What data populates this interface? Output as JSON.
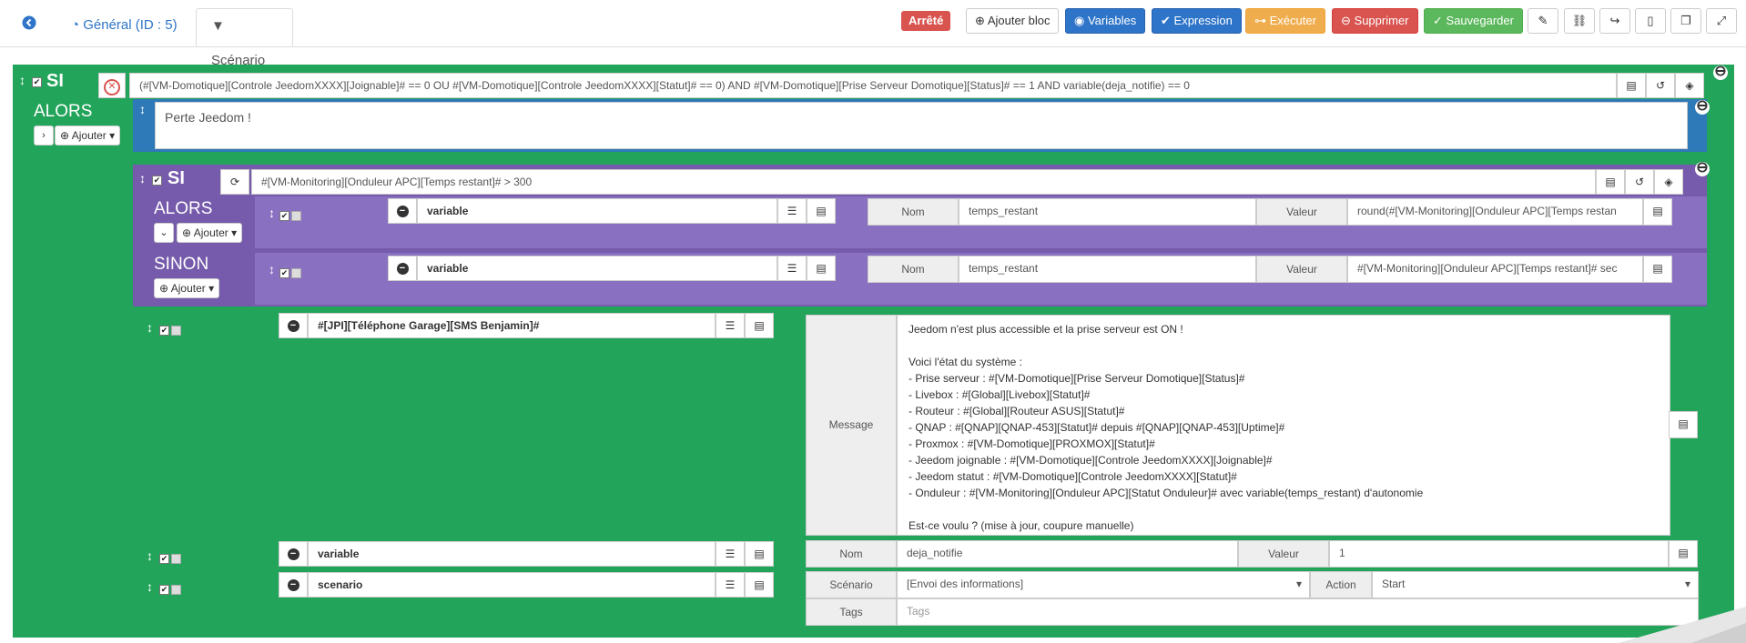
{
  "tabs": {
    "general": "Général (ID : 5)",
    "scenario": "Scénario"
  },
  "toolbar": {
    "state": "Arrêté",
    "add_block": "Ajouter bloc",
    "variables": "Variables",
    "expression": "Expression",
    "execute": "Exécuter",
    "delete": "Supprimer",
    "save": "Sauvegarder"
  },
  "si1": {
    "label": "SI",
    "condition": "(#[VM-Domotique][Controle JeedomXXXX][Joignable]# == 0 OU #[VM-Domotique][Controle JeedomXXXX][Statut]# == 0) AND #[VM-Domotique][Prise Serveur Domotique][Status]# == 1 AND variable(deja_notifie) == 0"
  },
  "alors1": {
    "label": "ALORS",
    "add": "Ajouter",
    "message": "Perte Jeedom !"
  },
  "si2": {
    "label": "SI",
    "condition": "#[VM-Monitoring][Onduleur APC][Temps restant]# > 300"
  },
  "alors2": {
    "label": "ALORS",
    "add": "Ajouter",
    "action": "variable",
    "name_label": "Nom",
    "name_value": "temps_restant",
    "value_label": "Valeur",
    "value": "round(#[VM-Monitoring][Onduleur APC][Temps restan"
  },
  "sinon": {
    "label": "SINON",
    "add": "Ajouter",
    "action": "variable",
    "name_label": "Nom",
    "name_value": "temps_restant",
    "value_label": "Valeur",
    "value": "#[VM-Monitoring][Onduleur APC][Temps restant]# sec"
  },
  "action_sms": {
    "cmd": "#[JPI][Téléphone Garage][SMS Benjamin]#",
    "message_label": "Message",
    "message_lines": [
      "Jeedom n'est plus accessible et la prise serveur est ON !",
      "",
      "Voici l'état du système :",
      "- Prise serveur : #[VM-Domotique][Prise Serveur Domotique][Status]#",
      "- Livebox : #[Global][Livebox][Statut]#",
      "- Routeur : #[Global][Routeur ASUS][Statut]#",
      "- QNAP : #[QNAP][QNAP-453][Statut]# depuis #[QNAP][QNAP-453][Uptime]#",
      "- Proxmox : #[VM-Domotique][PROXMOX][Statut]#",
      "- Jeedom joignable : #[VM-Domotique][Controle JeedomXXXX][Joignable]#",
      "- Jeedom statut : #[VM-Domotique][Controle JeedomXXXX][Statut]#",
      "- Onduleur : #[VM-Monitoring][Onduleur APC][Statut Onduleur]# avec variable(temps_restant) d'autonomie",
      "",
      "Est-ce voulu ? (mise à jour, coupure manuelle)"
    ]
  },
  "action_var": {
    "cmd": "variable",
    "name_label": "Nom",
    "name_value": "deja_notifie",
    "value_label": "Valeur",
    "value": "1"
  },
  "action_scen": {
    "cmd": "scenario",
    "scenario_label": "Scénario",
    "scenario_value": "[Envoi des informations]",
    "action_label": "Action",
    "action_value": "Start",
    "tags_label": "Tags",
    "tags_placeholder": "Tags"
  },
  "colors": {
    "si_green": "#22a45a",
    "alors_blue": "#2e79b8",
    "sinon_purple": "#765aab",
    "brand_blue": "#2e74c8"
  }
}
